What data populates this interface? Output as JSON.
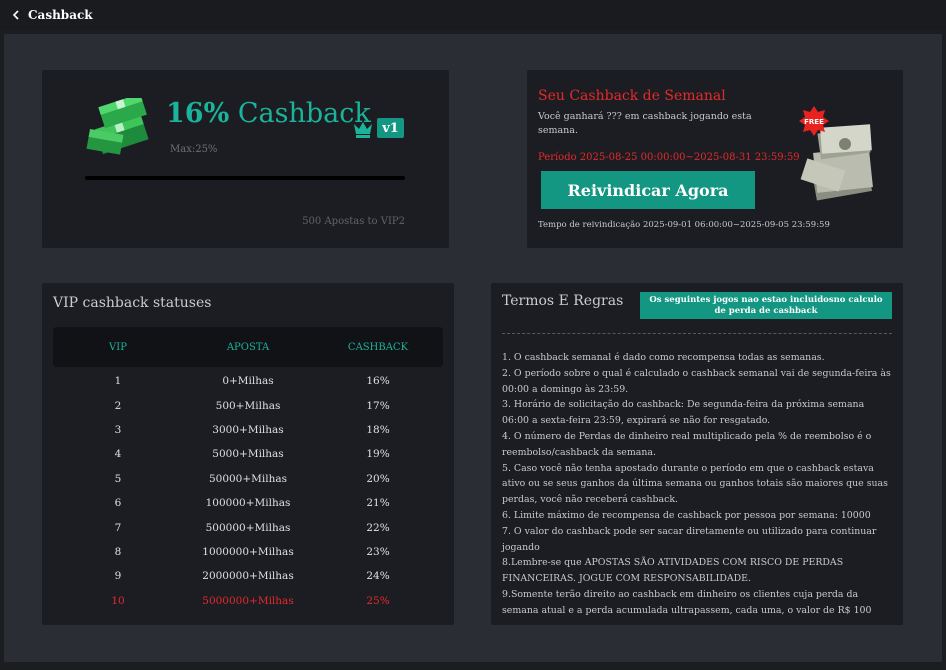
{
  "header": {
    "title": "Cashback"
  },
  "level_card": {
    "percent": "16%",
    "title_suffix": "Cashback",
    "max": "Max:25%",
    "vip_level": "v1",
    "progress_fraction": 0.0,
    "to_next": "500 Apostas to VIP2"
  },
  "weekly_card": {
    "title": "Seu Cashback de Semanal",
    "description": "Você ganhará ??? em cashback jogando esta semana.",
    "period": "Período 2025-08-25 00:00:00~2025-08-31 23:59:59",
    "claim_label": "Reivindicar Agora",
    "claim_time": "Tempo de reivindicação 2025-09-01 06:00:00~2025-09-05 23:59:59",
    "free_badge": "FREE"
  },
  "vip_card": {
    "title": "VIP cashback statuses",
    "columns": [
      "VIP",
      "APOSTA",
      "CASHBACK"
    ],
    "rows": [
      {
        "vip": "1",
        "bet": "0+Milhas",
        "cashback": "16%"
      },
      {
        "vip": "2",
        "bet": "500+Milhas",
        "cashback": "17%"
      },
      {
        "vip": "3",
        "bet": "3000+Milhas",
        "cashback": "18%"
      },
      {
        "vip": "4",
        "bet": "5000+Milhas",
        "cashback": "19%"
      },
      {
        "vip": "5",
        "bet": "50000+Milhas",
        "cashback": "20%"
      },
      {
        "vip": "6",
        "bet": "100000+Milhas",
        "cashback": "21%"
      },
      {
        "vip": "7",
        "bet": "500000+Milhas",
        "cashback": "22%"
      },
      {
        "vip": "8",
        "bet": "1000000+Milhas",
        "cashback": "23%"
      },
      {
        "vip": "9",
        "bet": "2000000+Milhas",
        "cashback": "24%"
      },
      {
        "vip": "10",
        "bet": "5000000+Milhas",
        "cashback": "25%"
      }
    ],
    "highlight_color": "#e52a2a"
  },
  "rules_card": {
    "title": "Termos E Regras",
    "excluded_games_label": "Os seguintes jogos nao estao incluidosno calculo de perda de cashback",
    "rules": [
      "1. O cashback semanal é dado como recompensa todas as semanas.",
      "2. O período sobre o qual é calculado o cashback semanal vai de segunda-feira às 00:00 a domingo às 23:59.",
      "3. Horário de solicitação do cashback: De segunda-feira da próxima semana 06:00 a sexta-feira 23:59, expirará se não for resgatado.",
      "4. O número de Perdas de dinheiro real multiplicado pela % de reembolso é o reembolso/cashback da semana.",
      "5. Caso você não tenha apostado durante o período em que o cashback estava ativo ou se seus ganhos da última semana ou ganhos totais são maiores que suas perdas, você não receberá cashback.",
      "6. Limite máximo de recompensa de cashback por pessoa por semana: 10000",
      "7. O valor do cashback pode ser sacar diretamente ou utilizado para continuar jogando",
      "8.Lembre-se que APOSTAS SÃO ATIVIDADES COM RISCO DE PERDAS FINANCEIRAS. JOGUE COM RESPONSABILIDADE.",
      "9.Somente terão direito ao cashback em dinheiro os clientes cuja perda da semana atual e a perda acumulada ultrapassem, cada uma, o valor de R$ 100"
    ]
  },
  "colors": {
    "accent": "#139682",
    "accent_text": "#1bb39a",
    "danger": "#e52a2a",
    "background": "#2a2d33",
    "card": "#1c1d22"
  }
}
